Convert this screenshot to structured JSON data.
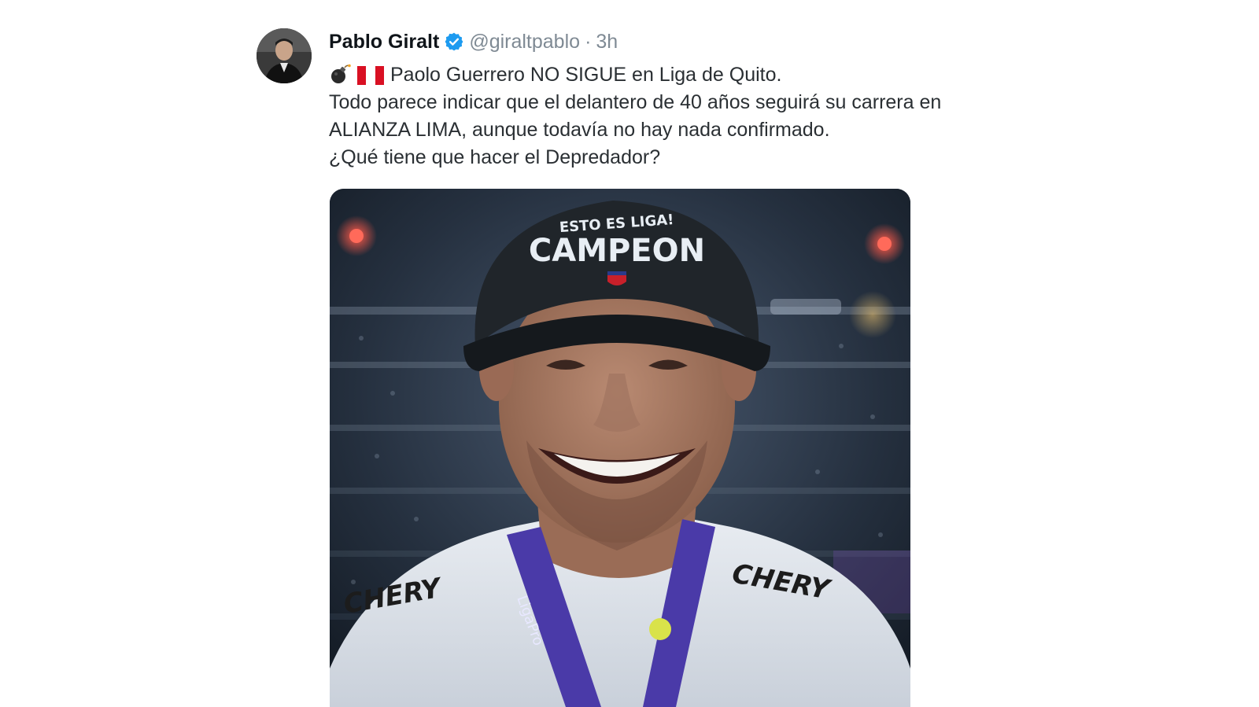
{
  "tweet": {
    "author_name": "Pablo Giralt",
    "handle": "@giraltpablo",
    "separator": "·",
    "time": "3h",
    "verified": true,
    "lines": [
      "Paolo Guerrero NO SIGUE en Liga de Quito.",
      "Todo parece indicar que el delantero de 40 años seguirá su carrera en",
      "ALIANZA LIMA, aunque todavía no hay nada confirmado.",
      "¿Qué tiene que hacer el Depredador?"
    ],
    "line1_icons": [
      "bomb-icon",
      "peru-flag-icon"
    ]
  },
  "media": {
    "cap_text_top": "ESTO ES LIGA!",
    "cap_text_main": "CAMPEON",
    "shirt_brand": "CHERY",
    "lanyard_text": "LigaPro"
  },
  "colors": {
    "verified": "#1d9bf0",
    "text": "#2a2f33",
    "muted": "#7f8a94",
    "flag_red": "#d91023"
  }
}
